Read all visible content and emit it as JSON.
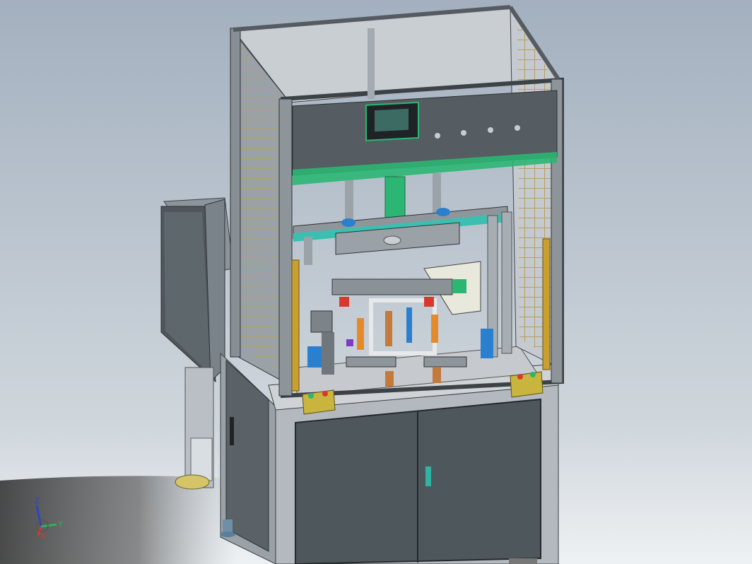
{
  "scene": {
    "description_kind": "cad-render",
    "background": {
      "top": "#a4b1bf",
      "bottom": "#e8ecef",
      "floor_shadow": "#3a3a3a"
    },
    "colors": {
      "frame_gray": "#7a8088",
      "frame_light": "#aab1b8",
      "panel_dark": "#4a5257",
      "panel_mid": "#5c6469",
      "mesh": "#c7b37a",
      "accent_green": "#2bb673",
      "accent_teal": "#3bbfb0",
      "hmi_screen": "#3b6b63",
      "button_box": "#c9b53d",
      "foot": "#d8c66a",
      "cylinder_blue": "#2b7fcf",
      "part_red": "#d63a2f",
      "part_orange": "#e58a2a"
    }
  },
  "triad": {
    "z_label": "Z",
    "y_label": "Y",
    "x_label": "X",
    "z_color": "#2a45c9",
    "y_color": "#2fb15a",
    "x_color": "#d63a2f"
  }
}
